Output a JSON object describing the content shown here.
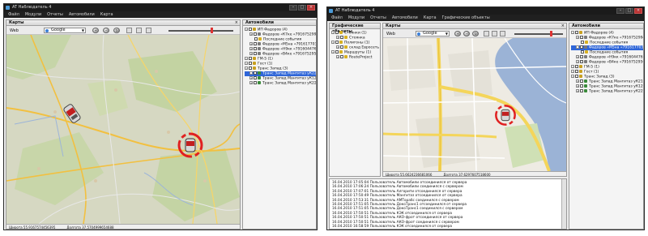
{
  "left_window": {
    "title": "AT Наблюдатель 4",
    "menu": [
      "Файл",
      "Модули",
      "Отчеты",
      "Автомобили",
      "Карта"
    ],
    "map_panel": {
      "header": "Карты",
      "provider_label": "Web",
      "map_source": "Google",
      "status": {
        "lat": "Широта 55.9167574456395",
        "lon": "Долгота 37.5704999654688"
      }
    },
    "tree_panel": {
      "header": "Автомобили",
      "items": [
        {
          "label": "ИП Фадоров (4)",
          "level": 0,
          "color": "#c8a020"
        },
        {
          "label": "Фадоров «К7ке «79167529947»",
          "level": 1,
          "color": "#7a7a7a"
        },
        {
          "label": "Последние события",
          "level": 2,
          "color": "#d8b020"
        },
        {
          "label": "Фадоров «М5на «79161770390»",
          "level": 1,
          "color": "#7a7a7a"
        },
        {
          "label": "Фадоров «Н9кк «79160447676»",
          "level": 1,
          "color": "#7a7a7a"
        },
        {
          "label": "Фадоров «В4ке «79167529569»",
          "level": 1,
          "color": "#7a7a7a"
        },
        {
          "label": "ГМ-5 (1)",
          "level": 0,
          "color": "#c8a020"
        },
        {
          "label": "Гост (1)",
          "level": 0,
          "color": "#c8a020"
        },
        {
          "label": "Транс Запад (3)",
          "level": 0,
          "color": "#c8a020"
        },
        {
          "label": "Транс Запад Мангитаз уК22е",
          "level": 1,
          "color": "#3a8a3a",
          "selected": true
        },
        {
          "label": "Транс Запад Мангитаз уК12е",
          "level": 1,
          "color": "#3a8a3a"
        },
        {
          "label": "Транс Запад Мангитаз уК22ол",
          "level": 1,
          "color": "#3a8a3a"
        }
      ]
    }
  },
  "right_window": {
    "title": "AT Наблюдатель 4",
    "menu": [
      "Файл",
      "Модули",
      "Отчеты",
      "Автомобили",
      "Карта",
      "Графические объекты"
    ],
    "objects_panel": {
      "header": "Графические объекты",
      "items": [
        {
          "label": "Стоянки (1)",
          "level": 0
        },
        {
          "label": "Стоянка",
          "level": 1
        },
        {
          "label": "Полигоны (1)",
          "level": 0
        },
        {
          "label": "склад Евросеть",
          "level": 1
        },
        {
          "label": "Маршруты (1)",
          "level": 0
        },
        {
          "label": "RouteProject",
          "level": 1
        }
      ]
    },
    "map_panel": {
      "header": "Карты",
      "provider_label": "Web",
      "map_source": "Google",
      "status": {
        "lat": "Широта 55.6624236681066",
        "lon": "Долгота 37.6297607518600"
      }
    },
    "tree_panel": {
      "header": "Автомобили",
      "items": [
        {
          "label": "ИП Фадоров (4)",
          "level": 0,
          "color": "#c8a020"
        },
        {
          "label": "Фадоров «К7ке «79167529947»",
          "level": 1,
          "color": "#7a7a7a"
        },
        {
          "label": "Последние события",
          "level": 2,
          "color": "#d8b020"
        },
        {
          "label": "Фадоров «М5на «79161770390»",
          "level": 1,
          "color": "#7a7a7a",
          "selected": true
        },
        {
          "label": "Последние события",
          "level": 2,
          "color": "#d8b020"
        },
        {
          "label": "Фадоров «Н9кк «79160447676»",
          "level": 1,
          "color": "#7a7a7a"
        },
        {
          "label": "Фадоров «В4ке «79167529569»",
          "level": 1,
          "color": "#7a7a7a"
        },
        {
          "label": "ГМ-5 (1)",
          "level": 0,
          "color": "#c8a020"
        },
        {
          "label": "Гост (1)",
          "level": 0,
          "color": "#c8a020"
        },
        {
          "label": "Транс Запад (3)",
          "level": 0,
          "color": "#c8a020"
        },
        {
          "label": "Транс Запад Мангитаз уК21е",
          "level": 1,
          "color": "#3a8a3a"
        },
        {
          "label": "Транс Запад Мангитаз уК12е",
          "level": 1,
          "color": "#3a8a3a"
        },
        {
          "label": "Транс Запад Мангитаз уК22ол",
          "level": 1,
          "color": "#3a8a3a"
        }
      ]
    },
    "log": [
      "16.04.2010 17:05:04 Пользователь Автомобили отсоединился от сервера",
      "16.04.2010 17:06:24 Пользователь Автомобили соединился с сервером",
      "16.04.2010 17:07:01 Пользователь Алгорити отсоединился от сервера",
      "16.04.2010 17:50:49 Пользователь Мангитаз отсоединился от сервера",
      "16.04.2010 17:53:31 Пользователь АМТорабс соединился с сервером",
      "16.04.2010 17:51:05 Пользователь ДокоТранс1 отсоединился от сервера",
      "16.04.2010 17:51:05 Пользователь ДокоТранс1 соединился с сервером",
      "16.04.2010 17:50:51 Пользователь КЭК отсоединился от сервера",
      "16.04.2010 17:50:51 Пользователь АКО-фрот отсоединился от сервера",
      "16.04.2010 17:50:51 Пользователь АКО-фрот соединился с сервером",
      "16.04.2010 16:58:59 Пользователь КЭК отсоединился от сервера"
    ]
  }
}
